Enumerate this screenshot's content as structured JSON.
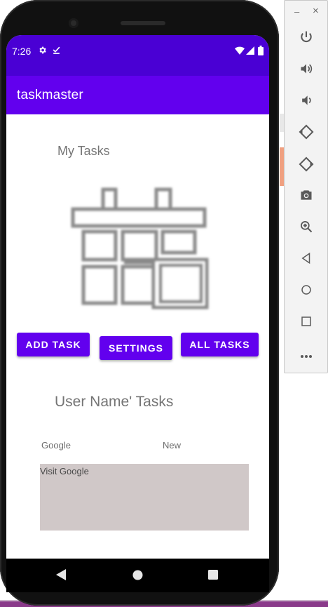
{
  "status_bar": {
    "time": "7:26",
    "left_icons": [
      "gear-icon",
      "download-done-icon"
    ],
    "right_icons": [
      "wifi-icon",
      "signal-icon",
      "battery-icon"
    ]
  },
  "app_bar": {
    "title": "taskmaster"
  },
  "main": {
    "heading": "My Tasks",
    "logo_icon": "calendar-grid-icon",
    "buttons": {
      "add_task": "ADD TASK",
      "settings": "SETTINGS",
      "all_tasks": "ALL TASKS"
    },
    "user_heading": "User Name' Tasks",
    "task_row": {
      "title": "Google",
      "state": "New"
    },
    "task_detail": "Visit Google"
  },
  "nav_bar": {
    "back": "back-icon",
    "home": "home-icon",
    "recents": "recents-icon"
  },
  "emulator_panel": {
    "minimize": "–",
    "close": "×",
    "tools": [
      "power-icon",
      "volume-up-icon",
      "volume-down-icon",
      "rotate-left-icon",
      "rotate-right-icon",
      "camera-icon",
      "zoom-icon",
      "back-icon",
      "home-icon",
      "overview-icon",
      "more-icon"
    ]
  },
  "colors": {
    "status_bar": "#4a00d4",
    "app_bar": "#6200ee",
    "button": "#6200ee",
    "task_box": "#d0c8c8"
  }
}
